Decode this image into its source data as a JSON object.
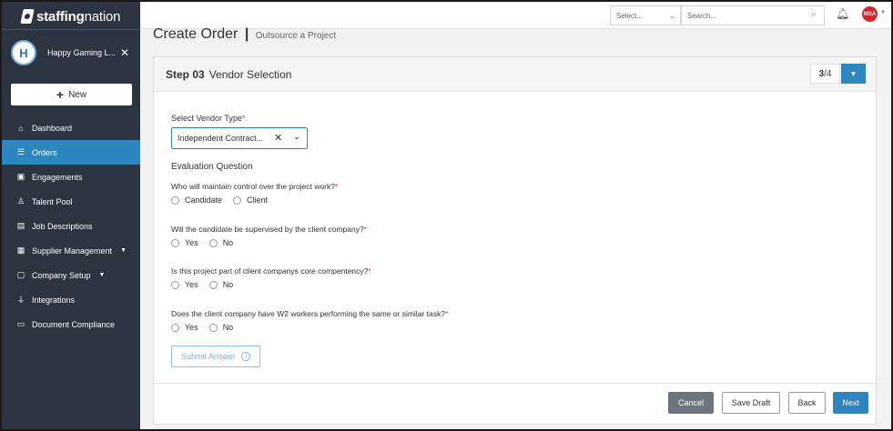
{
  "brand": {
    "name_bold": "staffing",
    "name_regular": "nation"
  },
  "company": {
    "initials": "H",
    "name": "Happy Gaming L...",
    "close": "✕"
  },
  "sidebar": {
    "new_button": "New",
    "items": [
      {
        "label": "Dashboard",
        "icon": "home-icon",
        "glyph": "⌂"
      },
      {
        "label": "Orders",
        "icon": "list-icon",
        "glyph": "☰"
      },
      {
        "label": "Engagements",
        "icon": "briefcase-icon",
        "glyph": "▣"
      },
      {
        "label": "Talent Pool",
        "icon": "person-icon",
        "glyph": "♙"
      },
      {
        "label": "Job Descriptions",
        "icon": "document-icon",
        "glyph": "▤"
      },
      {
        "label": "Supplier Management",
        "icon": "building-icon",
        "glyph": "▦"
      },
      {
        "label": "Company Setup",
        "icon": "window-icon",
        "glyph": "▢"
      },
      {
        "label": "Integrations",
        "icon": "plug-icon",
        "glyph": "⏚"
      },
      {
        "label": "Document Compliance",
        "icon": "folder-icon",
        "glyph": "▭"
      }
    ]
  },
  "topbar": {
    "select_placeholder": "Select...",
    "search_placeholder": "Search...",
    "user_initials": "MSA"
  },
  "page": {
    "title": "Create Order",
    "separator": "|",
    "subtitle": "Outsource a Project"
  },
  "step": {
    "number_label": "Step 03",
    "title": "Vendor Selection",
    "current": "3",
    "total": "/4"
  },
  "form": {
    "vendor_type_label": "Select Vendor Type",
    "vendor_type_value": "Independent Contract...",
    "evaluation_heading": "Evaluation Question",
    "required_mark": "*",
    "questions": [
      {
        "text": "Who will maintain control over the project work?",
        "options": [
          "Candidate",
          "Client"
        ]
      },
      {
        "text": "Will the candidate be supervised by the client company?",
        "options": [
          "Yes",
          "No"
        ]
      },
      {
        "text": "Is this project part of client companys core compentency?",
        "options": [
          "Yes",
          "No"
        ]
      },
      {
        "text": "Does the client company have W2 workers performing the same or similar task?",
        "options": [
          "Yes",
          "No"
        ]
      }
    ],
    "submit_label": "Submit Answer"
  },
  "footer": {
    "cancel": "Cancel",
    "save_draft": "Save Draft",
    "back": "Back",
    "next": "Next"
  },
  "colors": {
    "sidebar_bg": "#2b3440",
    "accent": "#2e86c1",
    "cancel_bg": "#6c757d",
    "avatar_red": "#d7232a"
  }
}
